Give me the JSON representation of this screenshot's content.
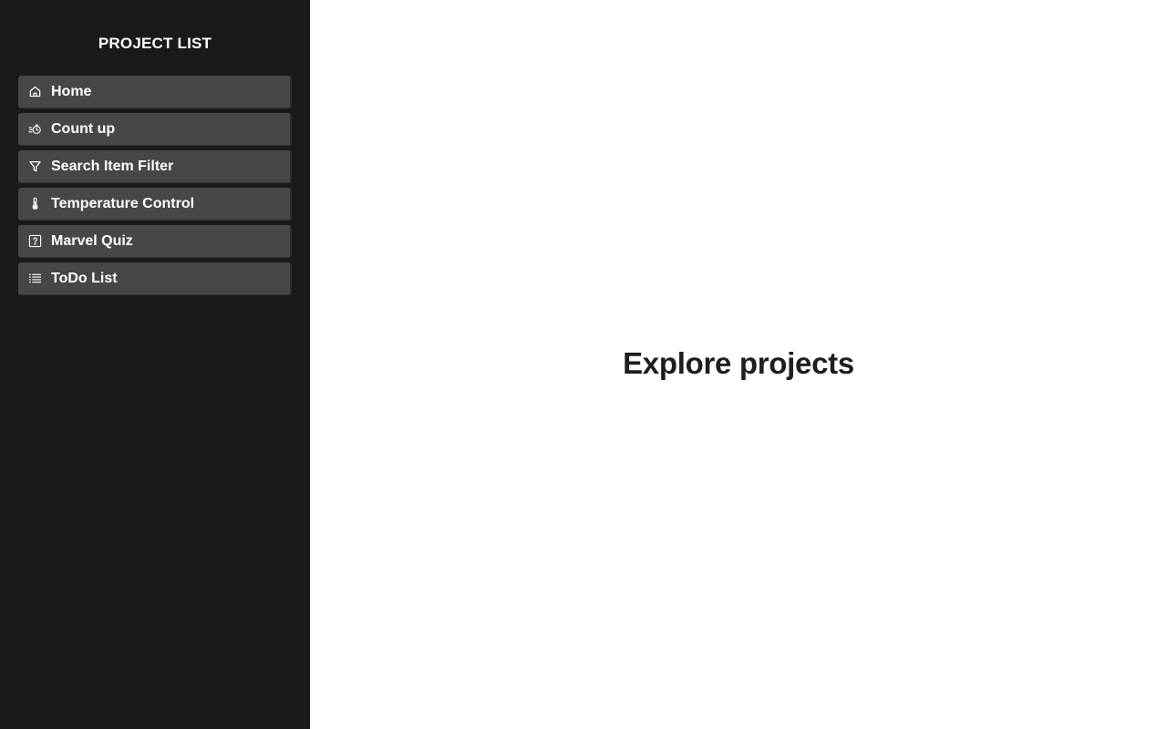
{
  "sidebar": {
    "title": "PROJECT LIST",
    "items": [
      {
        "label": "Home",
        "icon": "home-icon"
      },
      {
        "label": "Count up",
        "icon": "stopwatch-icon"
      },
      {
        "label": "Search Item Filter",
        "icon": "filter-icon"
      },
      {
        "label": "Temperature Control",
        "icon": "thermometer-icon"
      },
      {
        "label": "Marvel Quiz",
        "icon": "question-square-icon"
      },
      {
        "label": "ToDo List",
        "icon": "list-icon"
      }
    ]
  },
  "main": {
    "title": "Explore projects"
  },
  "colors": {
    "sidebar_bg": "#1a1a1a",
    "item_bg": "#474747",
    "main_bg": "#ffffff",
    "title_text": "#1e1e1e"
  }
}
